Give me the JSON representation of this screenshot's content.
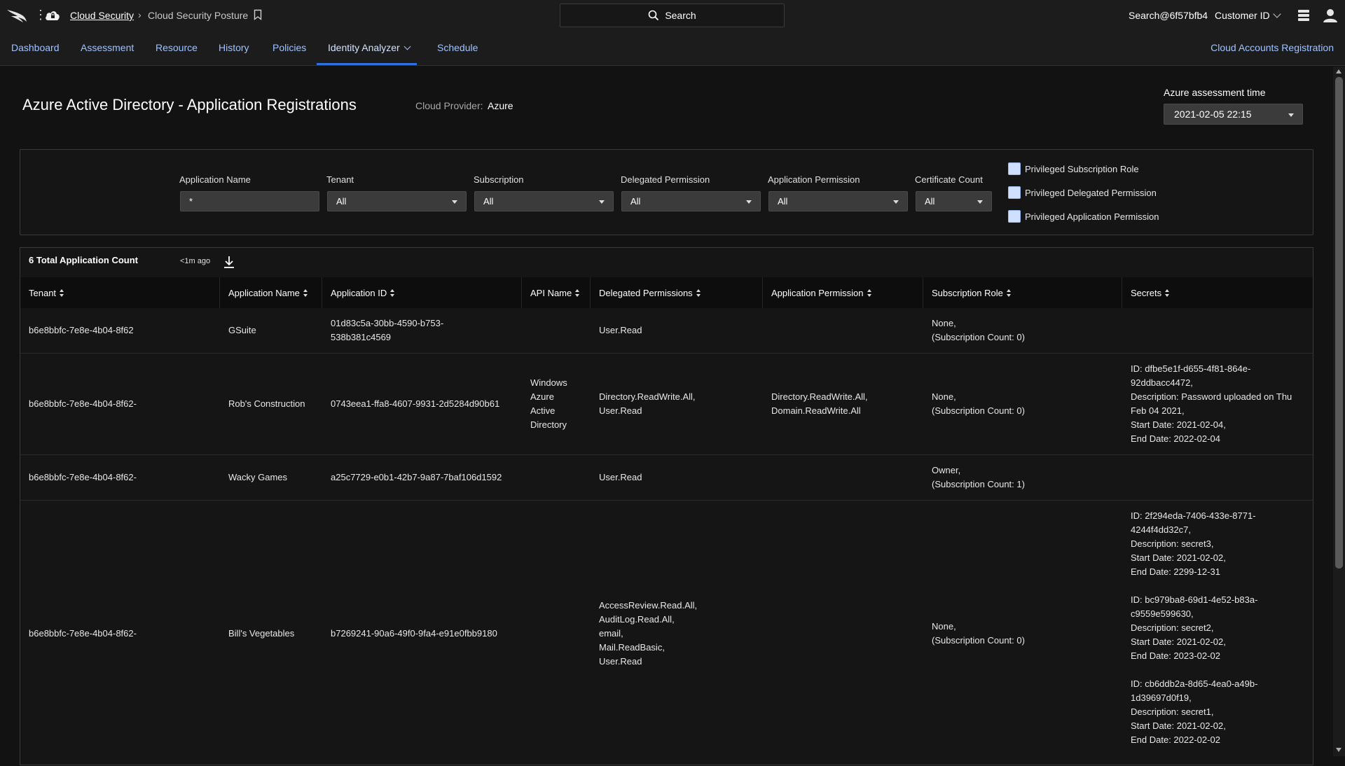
{
  "header": {
    "breadcrumb": [
      "Cloud Security",
      "Cloud Security Posture"
    ],
    "search_label": "Search",
    "user": "Search@6f57bfb4",
    "customer_id": "Customer ID"
  },
  "nav": {
    "tabs": [
      "Dashboard",
      "Assessment",
      "Resource",
      "History",
      "Policies",
      "Identity Analyzer",
      "Schedule"
    ],
    "active_tab": "Identity Analyzer",
    "right_link": "Cloud Accounts Registration"
  },
  "page": {
    "title": "Azure Active Directory - Application Registrations",
    "cloud_provider_label": "Cloud Provider:",
    "cloud_provider_value": "Azure",
    "assessment_time_label": "Azure assessment time",
    "assessment_time_value": "2021-02-05 22:15"
  },
  "filters": {
    "application_name": {
      "label": "Application Name",
      "value": "*"
    },
    "tenant": {
      "label": "Tenant",
      "value": "All"
    },
    "subscription": {
      "label": "Subscription",
      "value": "All"
    },
    "delegated_permission": {
      "label": "Delegated Permission",
      "value": "All"
    },
    "application_permission": {
      "label": "Application Permission",
      "value": "All"
    },
    "certificate_count": {
      "label": "Certificate Count",
      "value": "All"
    },
    "checkboxes": [
      "Privileged Subscription Role",
      "Privileged Delegated Permission",
      "Privileged Application Permission"
    ]
  },
  "results": {
    "count_label": "6 Total Application Count",
    "updated": "<1m ago",
    "columns": [
      "Tenant",
      "Application Name",
      "Application ID",
      "API Name",
      "Delegated Permissions",
      "Application Permission",
      "Subscription Role",
      "Secrets"
    ],
    "rows": [
      {
        "tenant": "b6e8bbfc-7e8e-4b04-8f62",
        "app_name": "GSuite",
        "app_id": "01d83c5a-30bb-4590-b753-\n538b381c4569",
        "api_name": "",
        "delegated": "User.Read",
        "app_permission": "",
        "sub_role": "None,\n(Subscription Count: 0)",
        "secrets": ""
      },
      {
        "tenant": "b6e8bbfc-7e8e-4b04-8f62-",
        "app_name": "Rob's Construction",
        "app_id": "0743eea1-ffa8-4607-9931-2d5284d90b61",
        "api_name": "Windows\nAzure\nActive\nDirectory",
        "delegated": "Directory.ReadWrite.All,\nUser.Read",
        "app_permission": "Directory.ReadWrite.All,\nDomain.ReadWrite.All",
        "sub_role": "None,\n(Subscription Count: 0)",
        "secrets": "ID: dfbe5e1f-d655-4f81-864e-\n92ddbacc4472,\nDescription: Password uploaded on Thu\nFeb 04 2021,\nStart Date: 2021-02-04,\nEnd Date: 2022-02-04"
      },
      {
        "tenant": "b6e8bbfc-7e8e-4b04-8f62-",
        "app_name": "Wacky Games",
        "app_id": "a25c7729-e0b1-42b7-9a87-7baf106d1592",
        "api_name": "",
        "delegated": "User.Read",
        "app_permission": "",
        "sub_role": "Owner,\n(Subscription Count: 1)",
        "secrets": ""
      },
      {
        "tenant": "b6e8bbfc-7e8e-4b04-8f62-",
        "app_name": "Bill's Vegetables",
        "app_id": "b7269241-90a6-49f0-9fa4-e91e0fbb9180",
        "api_name": "",
        "delegated": "AccessReview.Read.All,\nAuditLog.Read.All,\nemail,\nMail.ReadBasic,\nUser.Read",
        "app_permission": "",
        "sub_role": "None,\n(Subscription Count: 0)",
        "secrets": "ID: 2f294eda-7406-433e-8771-\n4244f4dd32c7,\nDescription: secret3,\nStart Date: 2021-02-02,\nEnd Date: 2299-12-31\n\nID: bc979ba8-69d1-4e52-b83a-\nc9559e599630,\nDescription: secret2,\nStart Date: 2021-02-02,\nEnd Date: 2023-02-02\n\nID: cb6ddb2a-8d65-4ea0-a49b-\n1d39697d0f19,\nDescription: secret1,\nStart Date: 2021-02-02,\nEnd Date: 2022-02-02"
      }
    ]
  }
}
